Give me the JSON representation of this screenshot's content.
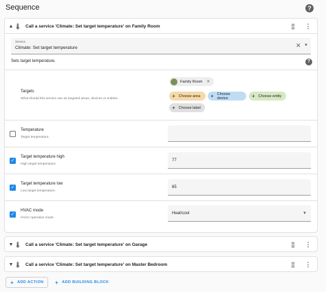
{
  "header": {
    "title": "Sequence",
    "help_icon": "help-circle-icon"
  },
  "action1": {
    "title": "Call a service 'Climate: Set target temperature' on Family Room",
    "service": {
      "label": "Service",
      "value": "Climate: Set target temperature"
    },
    "description": "Sets target temperature.",
    "targets": {
      "label": "Targets",
      "desc": "What should this service use as targeted areas, devices or entities.",
      "chip": "Family Room",
      "buttons": {
        "area": "Choose area",
        "device": "Choose device",
        "entity": "Choose entity",
        "label": "Choose label"
      }
    },
    "fields": [
      {
        "label": "Temperature",
        "desc": "Target temperature.",
        "checked": false,
        "value": ""
      },
      {
        "label": "Target temperature high",
        "desc": "High target temperature.",
        "checked": true,
        "value": "77"
      },
      {
        "label": "Target temperature low",
        "desc": "Low target temperature.",
        "checked": true,
        "value": "65"
      },
      {
        "label": "HVAC mode",
        "desc": "HVAC operation mode.",
        "checked": true,
        "value": "Heat/cool"
      }
    ]
  },
  "action2": {
    "title": "Call a service 'Climate: Set target temperature' on Garage"
  },
  "action3": {
    "title": "Call a service 'Climate: Set target temperature' on Master Bedroom"
  },
  "footer": {
    "add_action": "ADD ACTION",
    "add_building_block": "ADD BUILDING BLOCK"
  },
  "colors": {
    "accent": "#1e88e5",
    "area_chip": "#f6d9a8",
    "device_chip": "#bfdcf5",
    "entity_chip": "#d6e8c4",
    "label_chip": "#e0e0e0"
  }
}
